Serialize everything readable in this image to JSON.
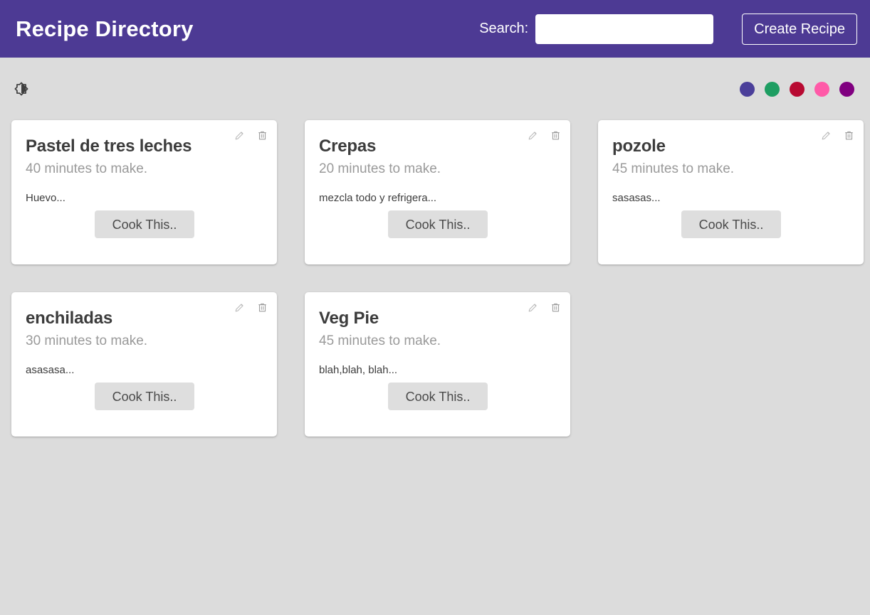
{
  "header": {
    "title": "Recipe Directory",
    "search_label": "Search:",
    "search_value": "",
    "search_placeholder": "",
    "create_button": "Create Recipe",
    "background_color": "#4d3a94"
  },
  "toolbar": {
    "theme_toggle_name": "brightness-icon",
    "swatches": [
      {
        "name": "swatch-purple",
        "color": "#4b3f9a"
      },
      {
        "name": "swatch-green",
        "color": "#1e9e62"
      },
      {
        "name": "swatch-crimson",
        "color": "#b80a32"
      },
      {
        "name": "swatch-pink",
        "color": "#ff5aa8"
      },
      {
        "name": "swatch-magenta",
        "color": "#800080"
      }
    ]
  },
  "cards": [
    {
      "title": "Pastel de tres leches",
      "time": "40 minutes to make.",
      "description": "Huevo...",
      "cook_label": "Cook This.."
    },
    {
      "title": "Crepas",
      "time": "20 minutes to make.",
      "description": "mezcla todo y refrigera...",
      "cook_label": "Cook This.."
    },
    {
      "title": "pozole",
      "time": "45 minutes to make.",
      "description": "sasasas...",
      "cook_label": "Cook This.."
    },
    {
      "title": "enchiladas",
      "time": "30 minutes to make.",
      "description": "asasasa...",
      "cook_label": "Cook This.."
    },
    {
      "title": "Veg Pie",
      "time": "45 minutes to make.",
      "description": "blah,blah, blah...",
      "cook_label": "Cook This.."
    }
  ],
  "page": {
    "background_color": "#dcdcdc"
  }
}
